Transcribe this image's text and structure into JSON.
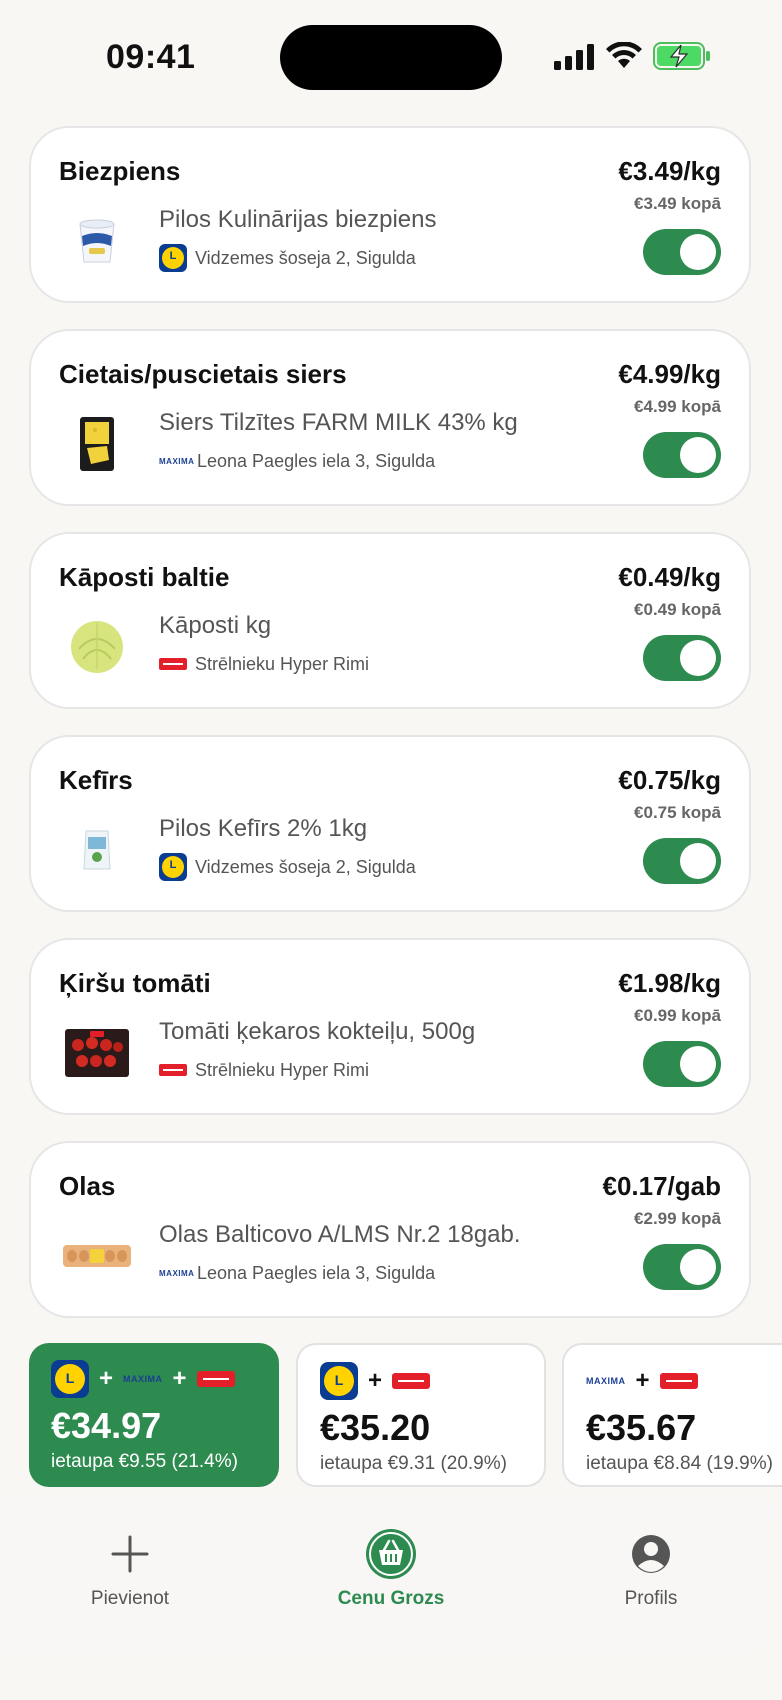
{
  "status_bar": {
    "time": "09:41"
  },
  "items": [
    {
      "category": "Biezpiens",
      "product": "Pilos Kulinārijas biezpiens",
      "store_chain": "lidl",
      "store_address": "Vidzemes šoseja 2, Sigulda",
      "unit_price": "€3.49/kg",
      "total": "€3.49 kopā",
      "enabled": true,
      "thumb_icon": "cottage-cheese-tub-icon"
    },
    {
      "category": "Cietais/puscietais siers",
      "product": "Siers Tilzītes FARM MILK 43% kg",
      "store_chain": "maxima",
      "store_address": "Leona Paegles iela 3, Sigulda",
      "unit_price": "€4.99/kg",
      "total": "€4.99 kopā",
      "enabled": true,
      "thumb_icon": "cheese-block-icon"
    },
    {
      "category": "Kāposti baltie",
      "product": "Kāposti kg",
      "store_chain": "rimi",
      "store_address": "Strēlnieku Hyper Rimi",
      "unit_price": "€0.49/kg",
      "total": "€0.49 kopā",
      "enabled": true,
      "thumb_icon": "cabbage-icon"
    },
    {
      "category": "Kefīrs",
      "product": "Pilos Kefīrs 2% 1kg",
      "store_chain": "lidl",
      "store_address": "Vidzemes šoseja 2, Sigulda",
      "unit_price": "€0.75/kg",
      "total": "€0.75 kopā",
      "enabled": true,
      "thumb_icon": "kefir-bag-icon"
    },
    {
      "category": "Ķiršu tomāti",
      "product": "Tomāti ķekaros kokteiļu, 500g",
      "store_chain": "rimi",
      "store_address": "Strēlnieku Hyper Rimi",
      "unit_price": "€1.98/kg",
      "total": "€0.99 kopā",
      "enabled": true,
      "thumb_icon": "tomatoes-pack-icon"
    },
    {
      "category": "Olas",
      "product": "Olas Balticovo A/LMS Nr.2 18gab.",
      "store_chain": "maxima",
      "store_address": "Leona Paegles iela 3, Sigulda",
      "unit_price": "€0.17/gab",
      "total": "€2.99 kopā",
      "enabled": true,
      "thumb_icon": "eggs-carton-icon"
    }
  ],
  "combos": [
    {
      "stores": [
        "lidl",
        "maxima",
        "rimi"
      ],
      "price": "€34.97",
      "savings": "ietaupa €9.55 (21.4%)",
      "selected": true
    },
    {
      "stores": [
        "lidl",
        "rimi"
      ],
      "price": "€35.20",
      "savings": "ietaupa €9.31 (20.9%)",
      "selected": false
    },
    {
      "stores": [
        "maxima",
        "rimi"
      ],
      "price": "€35.67",
      "savings": "ietaupa €8.84 (19.9%)",
      "selected": false
    }
  ],
  "logo_text": {
    "maxima": "MAXIMA"
  },
  "plus_sign": "+",
  "tabs": [
    {
      "label": "Pievienot",
      "icon": "plus-icon",
      "active": false
    },
    {
      "label": "Cenu Grozs",
      "icon": "basket-icon",
      "active": true
    },
    {
      "label": "Profils",
      "icon": "profile-icon",
      "active": false
    }
  ],
  "colors": {
    "accent": "#2e8b50",
    "background": "#f8f7f4",
    "lidl_blue": "#0a3d91",
    "lidl_yellow": "#ffd200",
    "rimi_red": "#e3202a",
    "maxima_blue": "#1b3f94"
  }
}
